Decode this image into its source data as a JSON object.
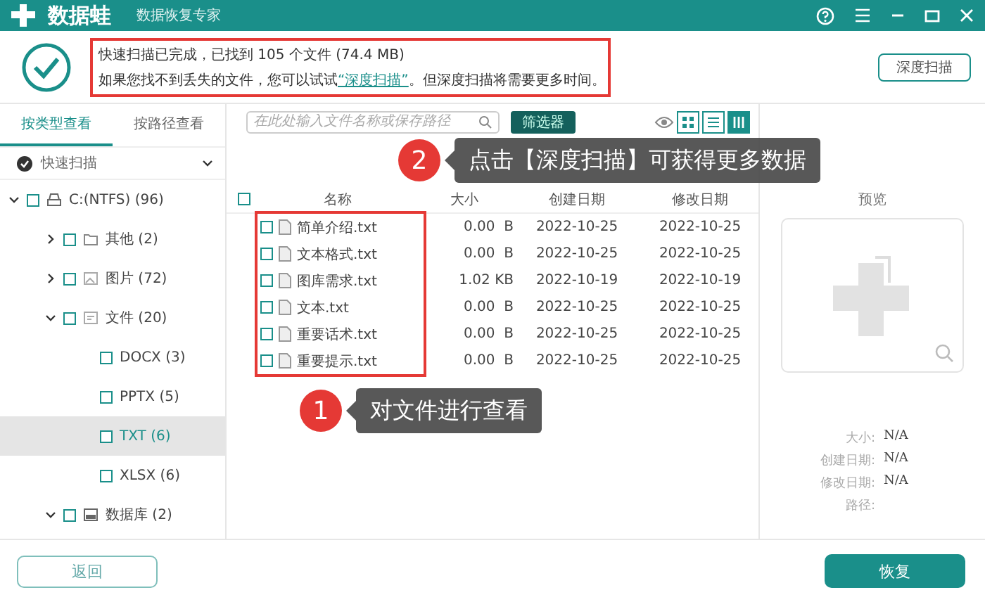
{
  "window": {
    "app_name": "数据蛙",
    "subtitle": "数据恢复专家"
  },
  "scan_summary": {
    "line_1": "快速扫描已完成，已找到 105 个文件 (74.4 MB)",
    "line_2_before": "如果您找不到丢失的文件，您可以试试",
    "line_2_link": "“深度扫描”",
    "line_2_after": "。但深度扫描将需要更多时间。",
    "deep_scan_button": "深度扫描"
  },
  "sidebar": {
    "tabs": [
      {
        "label": "按类型查看",
        "selected": true
      },
      {
        "label": "按路径查看",
        "selected": false
      }
    ],
    "scan_mode": "快速扫描",
    "tree": [
      {
        "label": "C:(NTFS) (96)",
        "kind": "drive",
        "expanded": true,
        "selected": false,
        "checked": false,
        "children": [
          {
            "label": "其他 (2)",
            "kind": "folder",
            "expanded": false,
            "selected": false,
            "checked": false
          },
          {
            "label": "图片 (72)",
            "kind": "image",
            "expanded": false,
            "selected": false,
            "checked": false
          },
          {
            "label": "文件 (20)",
            "kind": "document",
            "expanded": true,
            "selected": false,
            "checked": false,
            "children": [
              {
                "label": "DOCX (3)",
                "selected": false,
                "checked": false
              },
              {
                "label": "PPTX (5)",
                "selected": false,
                "checked": false
              },
              {
                "label": "TXT (6)",
                "selected": true,
                "checked": false
              },
              {
                "label": "XLSX (6)",
                "selected": false,
                "checked": false
              }
            ]
          },
          {
            "label": "数据库 (2)",
            "kind": "database",
            "expanded": true,
            "selected": false,
            "checked": false
          }
        ]
      }
    ]
  },
  "toolbar": {
    "search": {
      "placeholder": "在此处输入文件名称或保存路径"
    },
    "filter_button": "筛选器",
    "views": [
      {
        "kind": "grid",
        "selected": false
      },
      {
        "kind": "list",
        "selected": false
      },
      {
        "kind": "detail",
        "selected": true
      }
    ]
  },
  "table": {
    "select_all_checked": false,
    "columns": [
      "名称",
      "大小",
      "创建日期",
      "修改日期"
    ],
    "rows": [
      {
        "name": "简单介绍.txt",
        "size": "0.00  B",
        "created": "2022-10-25",
        "modified": "2022-10-25",
        "checked": false
      },
      {
        "name": "文本格式.txt",
        "size": "0.00  B",
        "created": "2022-10-25",
        "modified": "2022-10-25",
        "checked": false
      },
      {
        "name": "图库需求.txt",
        "size": "1.02 KB",
        "created": "2022-10-19",
        "modified": "2022-10-19",
        "checked": false
      },
      {
        "name": "文本.txt",
        "size": "0.00  B",
        "created": "2022-10-25",
        "modified": "2022-10-25",
        "checked": false
      },
      {
        "name": "重要话术.txt",
        "size": "0.00  B",
        "created": "2022-10-25",
        "modified": "2022-10-25",
        "checked": false
      },
      {
        "name": "重要提示.txt",
        "size": "0.00  B",
        "created": "2022-10-25",
        "modified": "2022-10-25",
        "checked": false
      }
    ]
  },
  "preview": {
    "title": "预览",
    "details": [
      {
        "label": "大小:",
        "value": "N/A"
      },
      {
        "label": "创建日期:",
        "value": "N/A"
      },
      {
        "label": "修改日期:",
        "value": "N/A"
      },
      {
        "label": "路径:"
      }
    ]
  },
  "footer": {
    "back_button": "返回",
    "recover_button": "恢复"
  },
  "callouts": [
    {
      "number": "2",
      "text": "点击【深度扫描】可获得更多数据"
    },
    {
      "number": "1",
      "text": "对文件进行查看"
    }
  ]
}
